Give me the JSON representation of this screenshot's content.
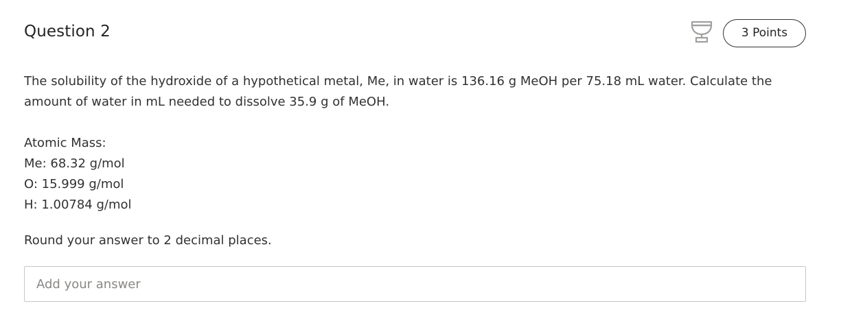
{
  "question": {
    "title": "Question 2",
    "points_label": "3 Points",
    "paragraph": "The solubility of the hydroxide of a hypothetical metal, Me, in water is 136.16 g MeOH per 75.18 mL water. Calculate the amount of water in mL needed to dissolve 35.9 g of MeOH.",
    "atomic_mass": {
      "heading": "Atomic Mass:",
      "lines": [
        "Me: 68.32 g/mol",
        "O: 15.999 g/mol",
        "H: 1.00784 g/mol"
      ]
    },
    "instruction": "Round your answer to 2 decimal places."
  },
  "answer_field": {
    "value": "",
    "placeholder": "Add your answer"
  },
  "icons": {
    "trophy": "trophy-icon"
  },
  "colors": {
    "text": "#323130",
    "icon": "#a19f9d",
    "border": "#c8c6c4"
  }
}
